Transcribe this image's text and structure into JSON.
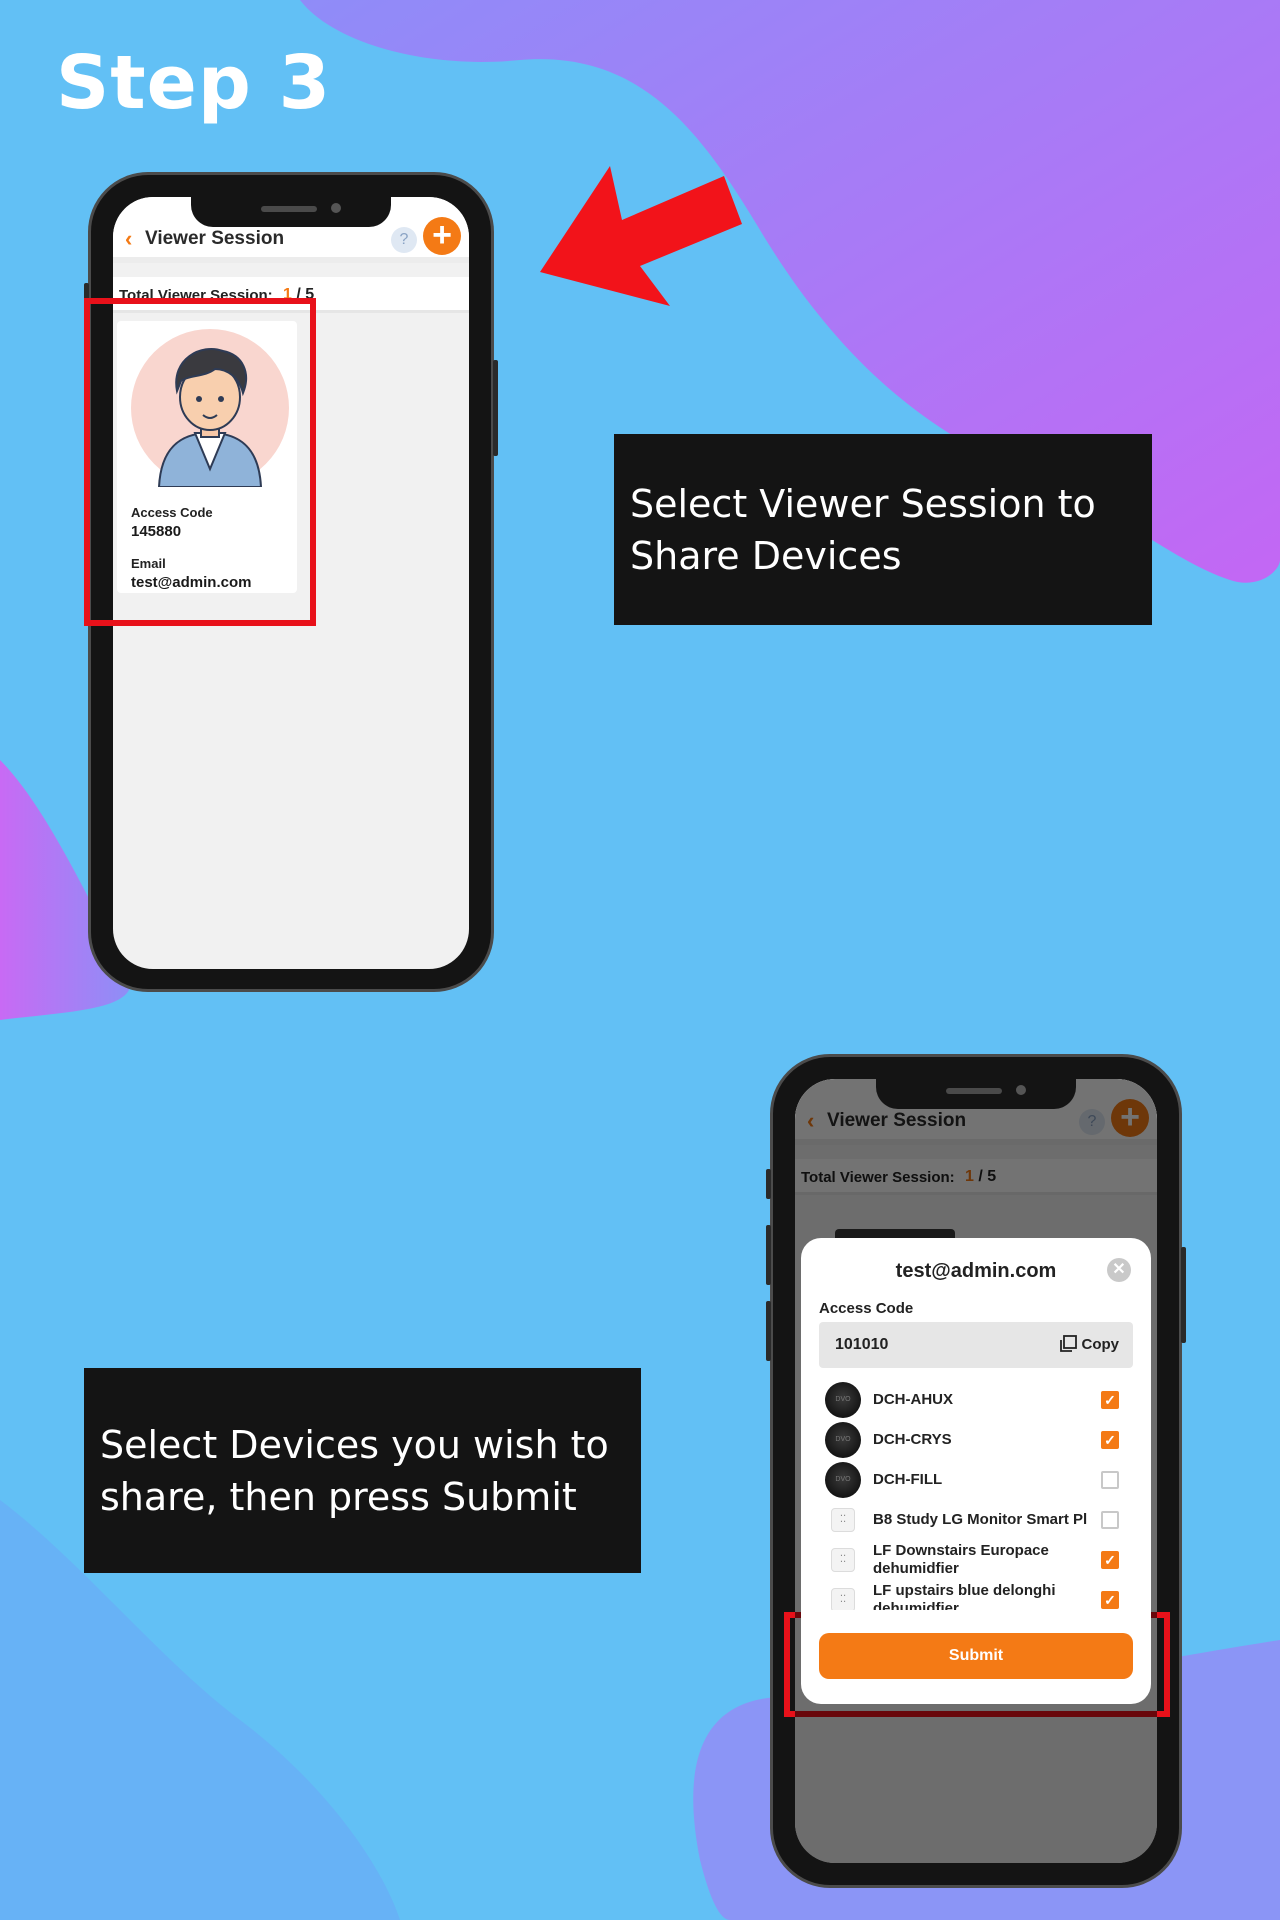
{
  "page": {
    "step_title": "Step 3",
    "caption_1": "Select Viewer Session to Share Devices",
    "caption_2": "Select Devices you wish to share, then press Submit"
  },
  "colors": {
    "accent": "#f47a15",
    "highlight": "#e8111a",
    "caption_bg": "#141414"
  },
  "app": {
    "header_title": "Viewer Session",
    "back_icon": "chevron-left-icon",
    "help_icon": "help-icon",
    "help_glyph": "?",
    "add_icon": "add-icon",
    "add_glyph": "+",
    "total_label": "Total Viewer Session:",
    "total_current": "1",
    "total_sep": " / ",
    "total_max": "5"
  },
  "session_card": {
    "access_code_label": "Access Code",
    "access_code": "145880",
    "email_label": "Email",
    "email": "test@admin.com"
  },
  "modal": {
    "title": "test@admin.com",
    "close_glyph": "✕",
    "access_code_label": "Access Code",
    "access_code": "101010",
    "copy_label": "Copy",
    "devices": [
      {
        "name": "DCH-AHUX",
        "icon": "dch-device-icon",
        "checked": true
      },
      {
        "name": "DCH-CRYS",
        "icon": "dch-device-icon",
        "checked": true
      },
      {
        "name": "DCH-FILL",
        "icon": "dch-device-icon",
        "checked": false
      },
      {
        "name": "B8 Study LG Monitor Smart Pl",
        "icon": "smart-plug-icon",
        "checked": false
      },
      {
        "name": "LF Downstairs Europace dehumidfier",
        "icon": "smart-plug-icon",
        "checked": true
      },
      {
        "name": "LF upstairs blue delonghi dehumidfier",
        "icon": "smart-plug-icon",
        "checked": true
      }
    ],
    "submit_label": "Submit"
  }
}
